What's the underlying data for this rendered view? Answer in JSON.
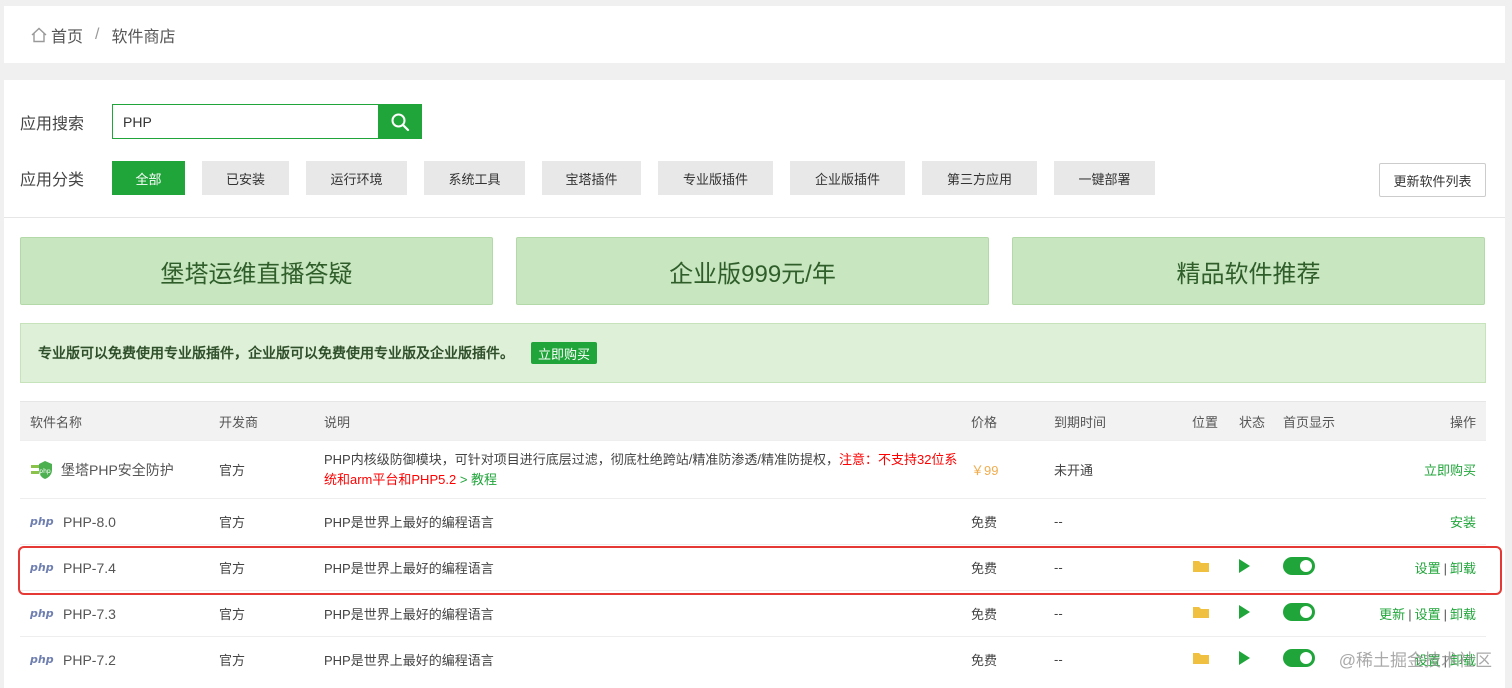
{
  "breadcrumb": {
    "home": "首页",
    "separator": "/",
    "current": "软件商店"
  },
  "search": {
    "label": "应用搜索",
    "value": "PHP"
  },
  "categories": {
    "label": "应用分类",
    "items": [
      "全部",
      "已安装",
      "运行环境",
      "系统工具",
      "宝塔插件",
      "专业版插件",
      "企业版插件",
      "第三方应用",
      "一键部署"
    ],
    "active_index": 0
  },
  "refresh_label": "更新软件列表",
  "promos": [
    "堡塔运维直播答疑",
    "企业版999元/年",
    "精品软件推荐"
  ],
  "notice": {
    "text": "专业版可以免费使用专业版插件，企业版可以免费使用专业版及企业版插件。",
    "button": "立即购买"
  },
  "table": {
    "headers": [
      "软件名称",
      "开发商",
      "说明",
      "价格",
      "到期时间",
      "位置",
      "状态",
      "首页显示",
      "操作"
    ],
    "rows": [
      {
        "name": "堡塔PHP安全防护",
        "vendor": "官方",
        "desc": "PHP内核级防御模块，可针对项目进行底层过滤，彻底杜绝跨站/精准防渗透/精准防提权，",
        "desc_warn": "注意：不支持32位系统和arm平台和PHP5.2",
        "desc_link": " > 教程",
        "price": "￥99",
        "expire": "未开通",
        "ops": [
          "立即购买"
        ]
      },
      {
        "name": "PHP-8.0",
        "vendor": "官方",
        "desc": "PHP是世界上最好的编程语言",
        "price": "免费",
        "expire": "--",
        "ops": [
          "安装"
        ]
      },
      {
        "name": "PHP-7.4",
        "vendor": "官方",
        "desc": "PHP是世界上最好的编程语言",
        "price": "免费",
        "expire": "--",
        "ops": [
          "设置",
          "卸载"
        ]
      },
      {
        "name": "PHP-7.3",
        "vendor": "官方",
        "desc": "PHP是世界上最好的编程语言",
        "price": "免费",
        "expire": "--",
        "ops": [
          "更新",
          "设置",
          "卸载"
        ]
      },
      {
        "name": "PHP-7.2",
        "vendor": "官方",
        "desc": "PHP是世界上最好的编程语言",
        "price": "免费",
        "expire": "--",
        "ops": [
          "设置",
          "卸载"
        ]
      }
    ],
    "php_logo": "php",
    "op_sep": "|"
  },
  "watermark": "@稀土掘金技术社区",
  "colors": {
    "accent": "#20a53a",
    "warn": "#ff0000",
    "price": "#f0ad4e",
    "highlight": "#e53935"
  }
}
